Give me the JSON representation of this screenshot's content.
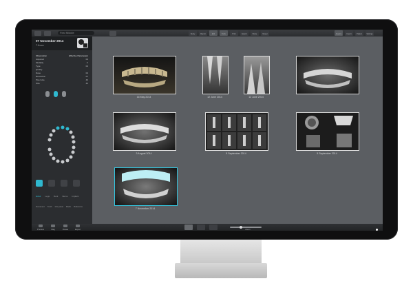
{
  "app": {
    "search_placeholder": "First Middle",
    "toolbar_left": [
      "Back",
      "Patient"
    ],
    "toolbar_center": [
      "Study",
      "Report",
      "Edit",
      "Tools",
      "Print",
      "Export",
      "Share",
      "Viewer"
    ],
    "toolbar_right": [
      "Acquire",
      "Import",
      "Patient",
      "Settings"
    ]
  },
  "sidebar": {
    "date": "07 November 2014",
    "patient_name": "T.Howe",
    "observation_title": "Observation",
    "exam_title": "Effective Parameters",
    "info_rows": [
      [
        "Acquired",
        "04"
      ],
      [
        "Modality",
        "F"
      ],
      [
        "Type",
        "04"
      ],
      [
        "Quality",
        ""
      ],
      [
        "Dose",
        "04"
      ],
      [
        "Resolution",
        "07"
      ],
      [
        "Pixel size",
        "40"
      ],
      [
        "Size",
        "42"
      ]
    ],
    "tabs": [
      "Eclair",
      "Legs",
      "Dent",
      "Nerve",
      "Implant"
    ],
    "footer": [
      "Document",
      "Tooth",
      "Info panel",
      "Radio",
      "Reference"
    ]
  },
  "thumbnails": [
    {
      "caption": "16 May 2014",
      "kind": "intraoral"
    },
    {
      "caption": "12 June 2014",
      "kind": "periapical"
    },
    {
      "caption": "12 June 2014",
      "kind": "periapical"
    },
    {
      "caption": "",
      "kind": "panoramic"
    },
    {
      "caption": "3 August 2014",
      "kind": "panoramic"
    },
    {
      "caption": "5 September 2014",
      "kind": "cbct-grid"
    },
    {
      "caption": "5 September 2014",
      "kind": "cbct-3d"
    },
    {
      "caption": "7 November 2014",
      "kind": "panoramic-selected"
    }
  ],
  "bottombar": {
    "left": [
      "Preview",
      "Mag",
      "Rotate",
      "Export"
    ],
    "views": [
      "grid",
      "list",
      "single"
    ],
    "zoom_label": "Zoom"
  },
  "colors": {
    "accent": "#2fb8cf",
    "screen_bg": "#5b5e62",
    "sidebar_bg": "#2b2d30"
  }
}
